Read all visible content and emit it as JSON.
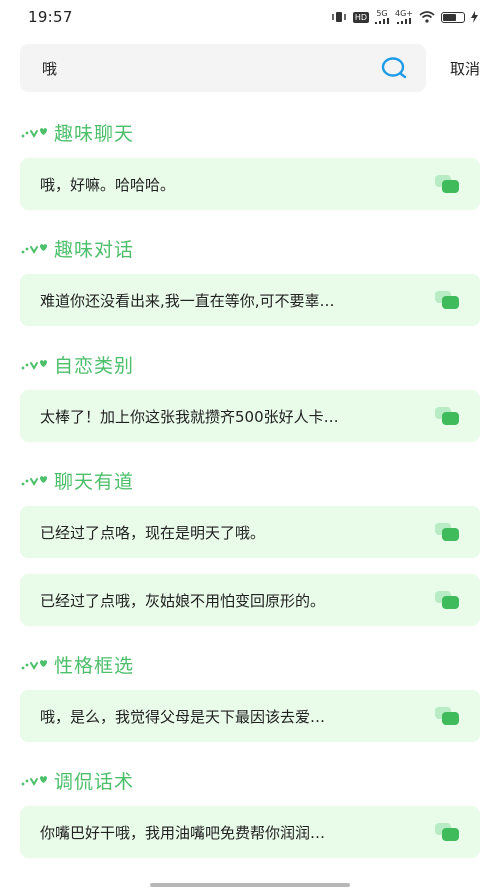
{
  "status_bar": {
    "time": "19:57",
    "network_5g": "5G",
    "network_4g": "4G+",
    "hd_label": "HD"
  },
  "search": {
    "value": "哦",
    "cancel_label": "取消"
  },
  "colors": {
    "accent": "#4cbf6b",
    "card_bg": "#e9fbe9"
  },
  "sections": [
    {
      "title": "趣味聊天",
      "items": [
        {
          "text": "哦，好嘛。哈哈哈。"
        }
      ]
    },
    {
      "title": "趣味对话",
      "items": [
        {
          "text": "难道你还没看出来,我一直在等你,可不要辜…"
        }
      ]
    },
    {
      "title": "自恋类别",
      "items": [
        {
          "text": "太棒了！加上你这张我就攒齐500张好人卡…"
        }
      ]
    },
    {
      "title": "聊天有道",
      "items": [
        {
          "text": "已经过了点咯，现在是明天了哦。"
        },
        {
          "text": "已经过了点哦，灰姑娘不用怕变回原形的。"
        }
      ]
    },
    {
      "title": "性格框选",
      "items": [
        {
          "text": "哦，是么，我觉得父母是天下最因该去爱…"
        }
      ]
    },
    {
      "title": "调侃话术",
      "items": [
        {
          "text": "你嘴巴好干哦，我用油嘴吧免费帮你润润…"
        }
      ]
    }
  ]
}
